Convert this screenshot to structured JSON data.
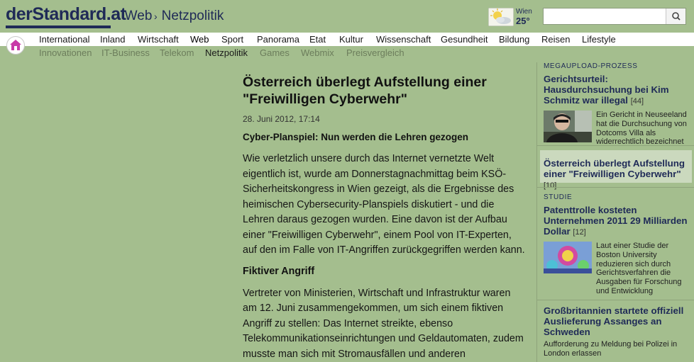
{
  "header": {
    "logo": "derStandard.at",
    "breadcrumb": [
      "Web",
      "Netzpolitik"
    ],
    "weather": {
      "city": "Wien",
      "temp": "25°"
    },
    "search": {
      "value": "",
      "placeholder": ""
    }
  },
  "nav": {
    "primary": [
      "International",
      "Inland",
      "Wirtschaft",
      "Web",
      "Sport",
      "Panorama",
      "Etat",
      "Kultur",
      "Wissenschaft",
      "Gesundheit",
      "Bildung",
      "Reisen",
      "Lifestyle"
    ],
    "primary_active": "Web",
    "secondary": [
      "Innovationen",
      "IT-Business",
      "Telekom",
      "Netzpolitik",
      "Games",
      "Webmix",
      "Preisvergleich"
    ],
    "secondary_active": "Netzpolitik"
  },
  "article": {
    "headline": "Österreich überlegt Aufstellung einer \"Freiwilligen Cyberwehr\"",
    "date": "28. Juni 2012, 17:14",
    "lead": "Cyber-Planspiel: Nun werden die Lehren gezogen",
    "para1": "Wie verletzlich unsere durch das Internet vernetzte Welt eigentlich ist, wurde am Donnerstagnachmittag beim KSÖ-Sicherheitskongress in Wien gezeigt, als die Ergebnisse des heimischen Cybersecurity-Planspiels diskutiert - und die Lehren daraus gezogen wurden. Eine davon ist der Aufbau einer \"Freiwilligen Cyberwehr\", einem Pool von IT-Experten, auf den im Falle von IT-Angriffen zurückgegriffen werden kann.",
    "subhead": "Fiktiver Angriff",
    "para2": "Vertreter von Ministerien, Wirtschaft und Infrastruktur waren am 12. Juni zusammengekommen, um sich einem fiktiven Angriff zu stellen: Das Internet streikte, ebenso Telekommunikationseinrichtungen und Geldautomaten, zudem musste man sich mit Stromausfällen und anderen \"Überraschungen\" auseinandersetzen. Die Fachleute mussten"
  },
  "sidebar": {
    "s1": {
      "kicker": "MEGAUPLOAD-PROZESS",
      "title": "Gerichtsurteil: Hausdurchsuchung bei Kim Schmitz war illegal",
      "count": "[44]",
      "text": "Ein Gericht in Neuseeland hat die Durchsuchung von Dotcoms Villa als widerrechtlich bezeichnet"
    },
    "s2": {
      "title": "Österreich überlegt Aufstellung einer \"Freiwilligen Cyberwehr\"",
      "count": "[10]"
    },
    "s3": {
      "kicker": "STUDIE",
      "title": "Patenttrolle kosteten Unternehmen 2011 29 Milliarden Dollar",
      "count": "[12]",
      "text": "Laut einer Studie der Boston University reduzieren sich durch Gerichtsverfahren die Ausgaben für Forschung und Entwicklung"
    },
    "s4": {
      "title": "Großbritannien startete offiziell Auslieferung Assanges an Schweden",
      "text": "Aufforderung zu Meldung bei Polizei in London erlassen"
    }
  },
  "colors": {
    "background": "#a4be8e",
    "brand": "#1f2a57",
    "highlight": "#cbd9be"
  }
}
